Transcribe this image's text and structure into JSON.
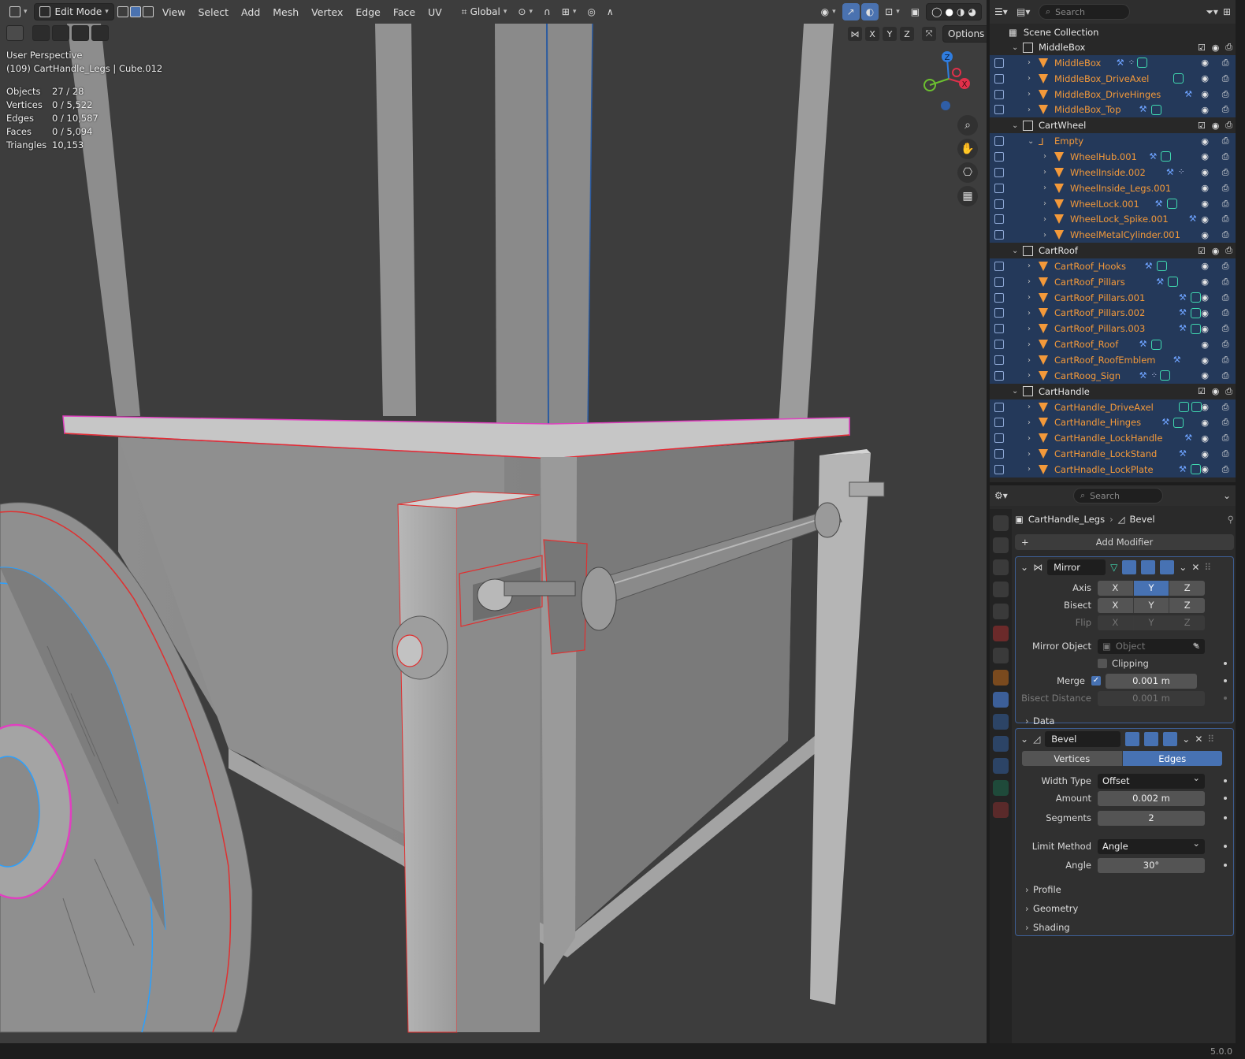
{
  "header": {
    "mode": "Edit Mode",
    "menus": [
      "View",
      "Select",
      "Add",
      "Mesh",
      "Vertex",
      "Edge",
      "Face",
      "UV"
    ],
    "orientation": "Global",
    "options_label": "Options",
    "axes": [
      "X",
      "Y",
      "Z"
    ]
  },
  "overlay": {
    "view": "User Perspective",
    "object": "(109) CartHandle_Legs | Cube.012",
    "stats": [
      {
        "label": "Objects",
        "value": "27 / 28"
      },
      {
        "label": "Vertices",
        "value": "0 / 5,522"
      },
      {
        "label": "Edges",
        "value": "0 / 10,587"
      },
      {
        "label": "Faces",
        "value": "0 / 5,094"
      },
      {
        "label": "Triangles",
        "value": "10,153"
      }
    ]
  },
  "gizmo": {
    "z": "Z",
    "x": "X"
  },
  "outliner": {
    "search_placeholder": "Search",
    "root": "Scene Collection",
    "rows": [
      {
        "name": "MiddleBox",
        "type": "col",
        "depth": 0,
        "mods": []
      },
      {
        "name": "MiddleBox",
        "type": "obj",
        "depth": 1,
        "mods": [
          "wrench",
          "verts",
          "mesh"
        ]
      },
      {
        "name": "MiddleBox_DriveAxel",
        "type": "obj",
        "depth": 1,
        "mods": [
          "mesh"
        ]
      },
      {
        "name": "MiddleBox_DriveHinges",
        "type": "obj",
        "depth": 1,
        "mods": [
          "wrench"
        ]
      },
      {
        "name": "MiddleBox_Top",
        "type": "obj",
        "depth": 1,
        "mods": [
          "wrench",
          "mesh"
        ]
      },
      {
        "name": "CartWheel",
        "type": "col",
        "depth": 0,
        "mods": []
      },
      {
        "name": "Empty",
        "type": "empty",
        "depth": 1,
        "mods": []
      },
      {
        "name": "WheelHub.001",
        "type": "obj",
        "depth": 2,
        "mods": [
          "wrench",
          "mesh"
        ]
      },
      {
        "name": "WheelInside.002",
        "type": "obj",
        "depth": 2,
        "mods": [
          "wrench",
          "verts"
        ]
      },
      {
        "name": "WheelInside_Legs.001",
        "type": "obj",
        "depth": 2,
        "mods": []
      },
      {
        "name": "WheelLock.001",
        "type": "obj",
        "depth": 2,
        "mods": [
          "wrench",
          "mesh"
        ]
      },
      {
        "name": "WheelLock_Spike.001",
        "type": "obj",
        "depth": 2,
        "mods": [
          "wrench"
        ]
      },
      {
        "name": "WheelMetalCylinder.001",
        "type": "obj",
        "depth": 2,
        "mods": []
      },
      {
        "name": "CartRoof",
        "type": "col",
        "depth": 0,
        "mods": []
      },
      {
        "name": "CartRoof_Hooks",
        "type": "obj",
        "depth": 1,
        "mods": [
          "wrench",
          "mesh"
        ]
      },
      {
        "name": "CartRoof_Pillars",
        "type": "obj",
        "depth": 1,
        "mods": [
          "wrench",
          "mesh"
        ]
      },
      {
        "name": "CartRoof_Pillars.001",
        "type": "obj",
        "depth": 1,
        "mods": [
          "wrench",
          "mesh"
        ]
      },
      {
        "name": "CartRoof_Pillars.002",
        "type": "obj",
        "depth": 1,
        "mods": [
          "wrench",
          "mesh"
        ]
      },
      {
        "name": "CartRoof_Pillars.003",
        "type": "obj",
        "depth": 1,
        "mods": [
          "wrench",
          "mesh"
        ]
      },
      {
        "name": "CartRoof_Roof",
        "type": "obj",
        "depth": 1,
        "mods": [
          "wrench",
          "mesh"
        ]
      },
      {
        "name": "CartRoof_RoofEmblem",
        "type": "obj",
        "depth": 1,
        "mods": [
          "wrench"
        ]
      },
      {
        "name": "CartRoog_Sign",
        "type": "obj",
        "depth": 1,
        "mods": [
          "wrench",
          "verts",
          "mesh"
        ]
      },
      {
        "name": "CartHandle",
        "type": "col",
        "depth": 0,
        "mods": []
      },
      {
        "name": "CartHandle_DriveAxel",
        "type": "obj",
        "depth": 1,
        "mods": [
          "mesh",
          "mesh"
        ]
      },
      {
        "name": "CartHandle_Hinges",
        "type": "obj",
        "depth": 1,
        "mods": [
          "wrench",
          "mesh"
        ]
      },
      {
        "name": "CartHandle_LockHandle",
        "type": "obj",
        "depth": 1,
        "mods": [
          "wrench"
        ]
      },
      {
        "name": "CartHandle_LockStand",
        "type": "obj",
        "depth": 1,
        "mods": [
          "wrench"
        ]
      },
      {
        "name": "CartHnadle_LockPlate",
        "type": "obj",
        "depth": 1,
        "mods": [
          "wrench",
          "mesh"
        ]
      }
    ]
  },
  "properties": {
    "search_placeholder": "Search",
    "breadcrumb_object": "CartHandle_Legs",
    "breadcrumb_modifier": "Bevel",
    "add_modifier": "Add Modifier",
    "mirror": {
      "name": "Mirror",
      "axis_label": "Axis",
      "bisect_label": "Bisect",
      "flip_label": "Flip",
      "axes": [
        "X",
        "Y",
        "Z"
      ],
      "mirror_object_label": "Mirror Object",
      "mirror_object_placeholder": "Object",
      "clipping_label": "Clipping",
      "merge_label": "Merge",
      "merge_value": "0.001 m",
      "bisect_distance_label": "Bisect Distance",
      "bisect_distance_value": "0.001 m",
      "data_label": "Data"
    },
    "bevel": {
      "name": "Bevel",
      "mode_vertices": "Vertices",
      "mode_edges": "Edges",
      "width_type_label": "Width Type",
      "width_type_value": "Offset",
      "amount_label": "Amount",
      "amount_value": "0.002 m",
      "segments_label": "Segments",
      "segments_value": "2",
      "limit_method_label": "Limit Method",
      "limit_method_value": "Angle",
      "angle_label": "Angle",
      "angle_value": "30°",
      "profile_label": "Profile",
      "geometry_label": "Geometry",
      "shading_label": "Shading"
    }
  },
  "status": {
    "version": "5.0.0"
  },
  "colors": {
    "selected_edge": "#e03030",
    "active_outline": "#e040c0",
    "seam": "#2aa0ff",
    "accent": "#4772b3",
    "object_name": "#f3993a"
  }
}
